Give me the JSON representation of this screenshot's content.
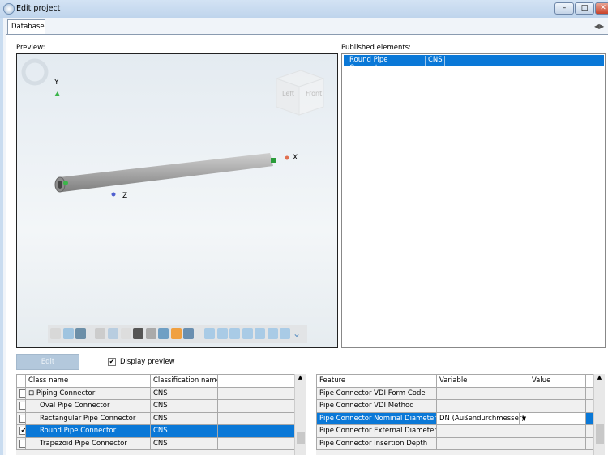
{
  "window": {
    "title": "Edit project",
    "minimize": "–",
    "maximize": "□",
    "close": "✕"
  },
  "tabs": [
    {
      "label": "Database",
      "active": true
    }
  ],
  "tab_scroll": {
    "left": "◀",
    "right": "▶"
  },
  "preview": {
    "label": "Preview:",
    "axes": {
      "x": "X",
      "y": "Y",
      "z": "Z"
    },
    "view_cube": {
      "left": "Left",
      "front": "Front"
    },
    "toolbar_icons": [
      "wireframe-icon",
      "shaded-icon",
      "shaded-edges-icon",
      "zoom-icon",
      "zoom-window-icon",
      "rotate-icon",
      "measure-icon",
      "sphere-icon",
      "section-icon",
      "color-icon",
      "cube-icon",
      "view-iso-1-icon",
      "view-iso-2-icon",
      "view-iso-3-icon",
      "view-iso-4-icon",
      "view-iso-5-icon",
      "view-iso-6-icon",
      "view-iso-7-icon",
      "more-chevron-icon"
    ]
  },
  "published": {
    "label": "Published elements:",
    "rows": [
      {
        "name": "Round Pipe Connector",
        "classification": "CNS",
        "selected": true
      }
    ]
  },
  "edit_button": "Edit",
  "display_preview": {
    "label": "Display preview",
    "checked": true
  },
  "class_table": {
    "headers": [
      "Class name",
      "Classification name",
      ""
    ],
    "rows": [
      {
        "expander": "⊟",
        "name": "Piping Connector",
        "classification": "CNS",
        "checked": false,
        "selected": false
      },
      {
        "name": "Oval Pipe Connector",
        "classification": "CNS",
        "checked": false,
        "selected": false
      },
      {
        "name": "Rectangular Pipe Connector",
        "classification": "CNS",
        "checked": false,
        "selected": false
      },
      {
        "name": "Round Pipe Connector",
        "classification": "CNS",
        "checked": true,
        "selected": true
      },
      {
        "name": "Trapezoid Pipe Connector",
        "classification": "CNS",
        "checked": false,
        "selected": false
      }
    ]
  },
  "feature_table": {
    "headers": [
      "Feature",
      "Variable",
      "Value"
    ],
    "rows": [
      {
        "feature": "Pipe Connector VDI Form Code",
        "variable": "",
        "value": ""
      },
      {
        "feature": "Pipe Connector VDI Method",
        "variable": "",
        "value": ""
      },
      {
        "feature": "Pipe Connector Nominal Diameter",
        "variable": "DN (Außendurchmesser)",
        "value": "",
        "selected": true
      },
      {
        "feature": "Pipe Connector External Diameter",
        "variable": "",
        "value": ""
      },
      {
        "feature": "Pipe Connector Insertion Depth",
        "variable": "",
        "value": ""
      }
    ]
  },
  "colors": {
    "selection": "#0a78d7",
    "titlebar": "#c9dcf0"
  }
}
